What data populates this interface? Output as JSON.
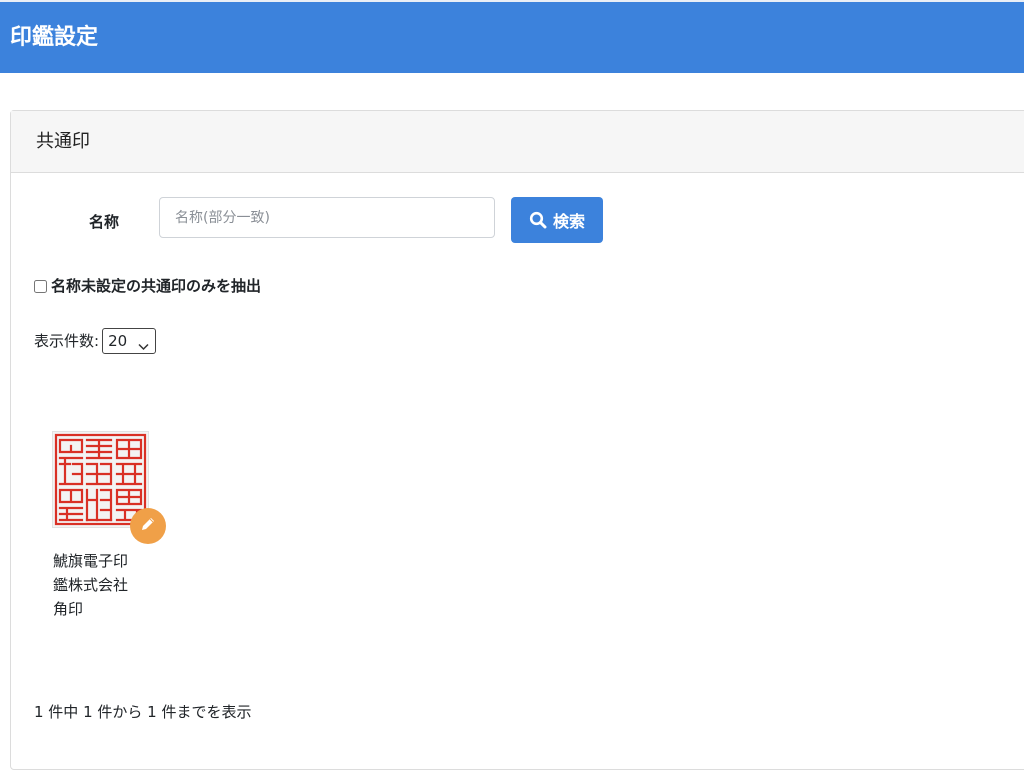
{
  "header": {
    "title": "印鑑設定",
    "background_color": "#3c82dc"
  },
  "card": {
    "title": "共通印"
  },
  "search": {
    "name_label": "名称",
    "placeholder": "名称(部分一致)",
    "value": "",
    "button_label": "検索",
    "button_icon": "search-icon"
  },
  "filter": {
    "checkbox_label": "名称未設定の共通印のみを抽出",
    "checked": false
  },
  "display_count": {
    "label": "表示件数:",
    "selected": "20"
  },
  "seals": [
    {
      "caption_lines": [
        "鯱旗電子印",
        "鑑株式会社",
        "角印"
      ],
      "image_color": "#d93025",
      "edit_icon": "pencil-icon",
      "edit_color": "#f0a048"
    }
  ],
  "pagination": {
    "summary": "1 件中 1 件から 1 件までを表示"
  }
}
